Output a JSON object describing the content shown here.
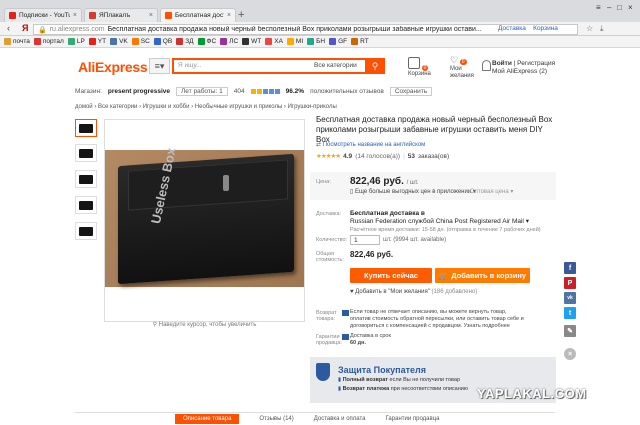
{
  "browser": {
    "tabs": [
      {
        "label": "Подписки - YouTube",
        "icon": "youtube-icon",
        "color": "#e62117"
      },
      {
        "label": "ЯПлакалъ",
        "icon": "yaplakal-icon",
        "color": "#d93a2b"
      },
      {
        "label": "Бесплатная доставка",
        "icon": "aliexpress-icon",
        "color": "#ff4f00"
      }
    ],
    "new_tab": "+",
    "back": "‹",
    "yandex_logo": "Я",
    "url_domain": "ru.aliexpress.com",
    "url_title": "Бесплатная доставка продажа новый черный бесполезный Box приколами розыгрыши забавные игрушки остави...",
    "url_actions": [
      "Доставка",
      "Корзина"
    ],
    "bookmarks": [
      "почта",
      "портал",
      "LP",
      "YT",
      "VK",
      "SC",
      "QB",
      "ЗД",
      "ФС",
      "ЛС",
      "WT",
      "ХА",
      "MI",
      "БН",
      "GF",
      "RT"
    ]
  },
  "header": {
    "logo": "AliExpress",
    "menu_icon": "≡▾",
    "search_placeholder": "Я ищу...",
    "category": "Все категории",
    "cart_count": "0",
    "cart_label": "Корзина",
    "wish_count": "0",
    "wish_label": "Мои желания",
    "login": "Войти",
    "register": "Регистрация",
    "my_ali": "Мой AliExpress",
    "my_ali_count": "(2)"
  },
  "store": {
    "label": "Магазин:",
    "name": "present progressive",
    "years": "Лет работы: 1",
    "score": "404",
    "positive": "96.2%",
    "positive_label": "положительных отзывов",
    "save_btn": "Сохранить"
  },
  "breadcrumb": "домой › Все категории › Игрушки и хобби › Необычные игрушки и приколы › Игрушки-приколы",
  "gallery": {
    "box_text": "Useless Box",
    "zoom_hint": "Наведите курсор, чтобы увеличить"
  },
  "product": {
    "title": "Бесплатная доставка продажа новый черный бесполезный Box приколами розыгрыши забавные игрушки оставить меня DIY Box",
    "translate": "Посмотреть название на английском",
    "rating": "4.9",
    "reviews": "(14 голосов(а))",
    "orders_num": "53",
    "orders_label": "заказа(ов)",
    "price_label": "Цена:",
    "price": "822,46 руб.",
    "price_unit": "/ шт.",
    "buyers_note": "Еще больше выгодных цен в приложении",
    "wholesale": "Оптовая цена",
    "ship_label": "Доставка:",
    "ship_title": "Бесплатная доставка в",
    "ship_route": "Russian Federation службой China Post Registered Air Mail",
    "ship_time": "Расчётное время доставки: 15-58 дн. (отправка в течение 7 рабочих дней)",
    "qty_label": "Количество:",
    "qty": "1",
    "qty_avail": "шт. (9994 шт. available)",
    "total_label": "Общая стоимость:",
    "total": "822,46 руб.",
    "buy_now": "Купить сейчас",
    "add_to_cart": "Добавить в корзину",
    "wishlist": "Добавить в \"Мои желания\"",
    "wishlist_count": "(186 добавлено)",
    "return_label": "Возврат товара:",
    "return_text": "Если товар не отвечает описанию, вы можете вернуть товар, оплатив стоимость обратной пересылки, или оставить товар себе и договориться с компенсацией с продавцом. Узнать подробнее",
    "guarantee_label": "Гарантии продавца:",
    "guarantee_text": "Доставка в срок",
    "guarantee_days": "60 дн."
  },
  "protection": {
    "title": "Защита Покупателя",
    "line1_bold": "Полный возврат",
    "line1": "если Вы не получили товар",
    "line2_bold": "Возврат платежа",
    "line2": "при несоответствии описанию"
  },
  "bottom_tabs": [
    "Описание товара",
    "Отзывы (14)",
    "Доставка и оплата",
    "Гарантии продавца"
  ],
  "social": [
    {
      "icon": "facebook-icon",
      "glyph": "f",
      "color": "#3b5998"
    },
    {
      "icon": "pinterest-icon",
      "glyph": "P",
      "color": "#cb2027"
    },
    {
      "icon": "vk-icon",
      "glyph": "vk",
      "color": "#4c75a3"
    },
    {
      "icon": "twitter-icon",
      "glyph": "t",
      "color": "#1da1f2"
    },
    {
      "icon": "edit-icon",
      "glyph": "✎",
      "color": "#888888"
    },
    {
      "icon": "close-icon",
      "glyph": "×",
      "color": "#bbbbbb"
    }
  ],
  "watermark": "YAPLAKAL.COM",
  "colors": {
    "accent": "#ff4f00",
    "buy": "#ff5b00",
    "cart": "#ff7a00",
    "link": "#2a62b8"
  }
}
